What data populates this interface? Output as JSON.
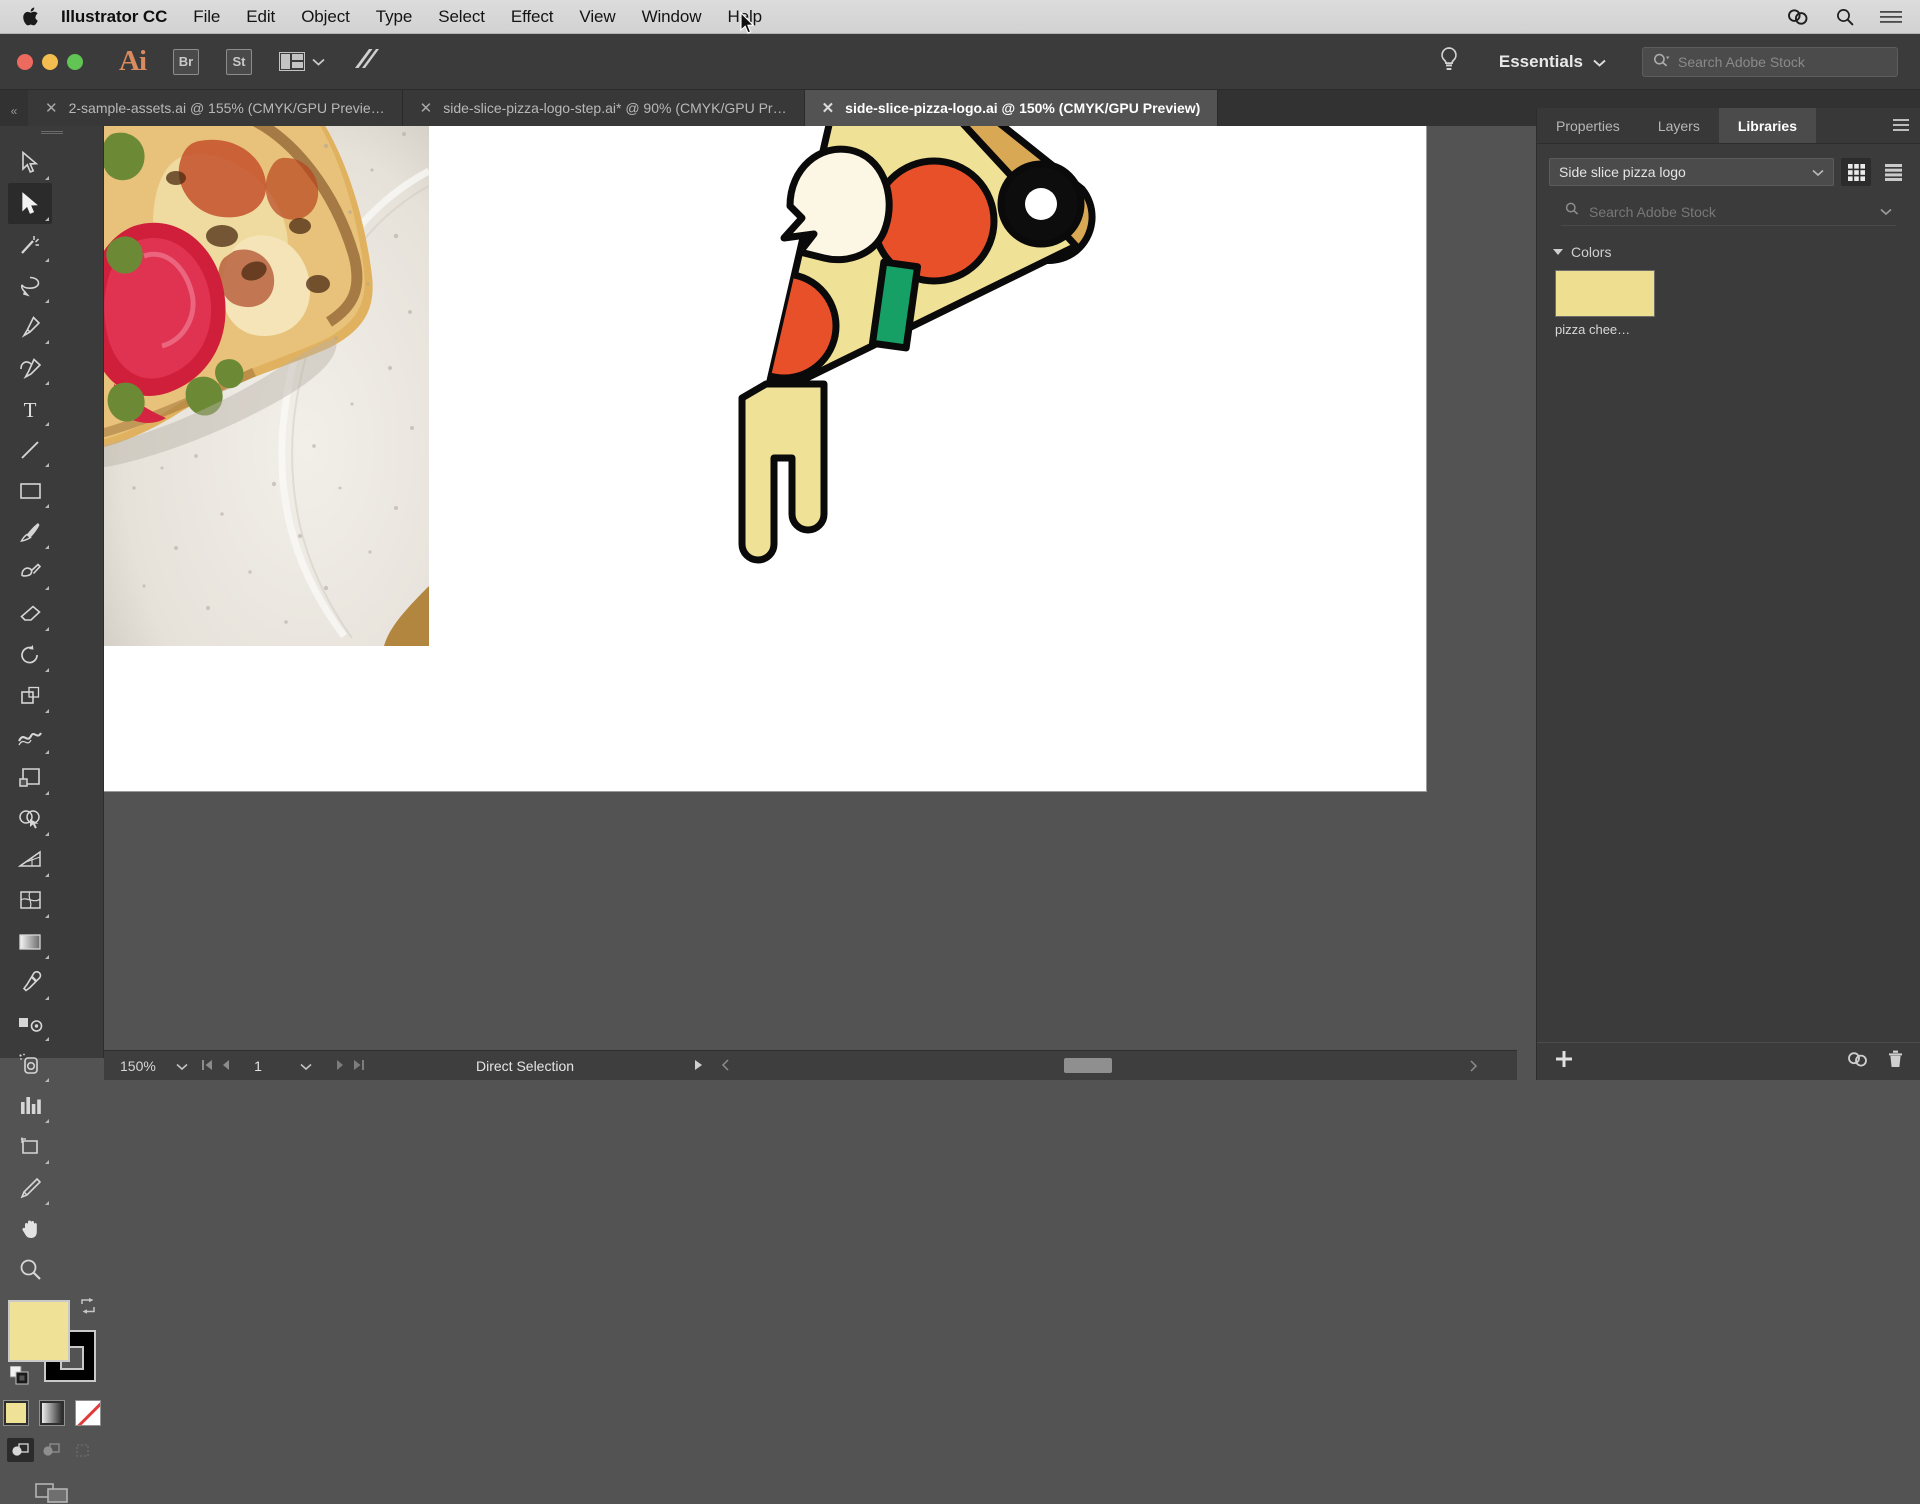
{
  "mac_menu": {
    "app_name": "Illustrator CC",
    "items": [
      "File",
      "Edit",
      "Object",
      "Type",
      "Select",
      "Effect",
      "View",
      "Window",
      "Help"
    ],
    "right_icons": [
      "creative-cloud-icon",
      "spotlight-search-icon",
      "control-center-icon"
    ]
  },
  "app_bar": {
    "logo": "Ai",
    "bridge_label": "Br",
    "stock_label": "St",
    "arrange_label": "arrange-documents-icon",
    "stylize_label": "stylize-icon",
    "bulb_label": "tips-icon",
    "workspace": "Essentials",
    "search_placeholder": "Search Adobe Stock"
  },
  "tabs": [
    {
      "title": "2-sample-assets.ai @ 155% (CMYK/GPU Previe…",
      "active": false
    },
    {
      "title": "side-slice-pizza-logo-step.ai* @ 90% (CMYK/GPU Pr…",
      "active": false
    },
    {
      "title": "side-slice-pizza-logo.ai @ 150% (CMYK/GPU Preview)",
      "active": true
    }
  ],
  "toolbar": {
    "tools": [
      "selection-tool",
      "direct-selection-tool",
      "magic-wand-tool",
      "lasso-tool",
      "pen-tool",
      "curvature-tool",
      "type-tool",
      "line-segment-tool",
      "rectangle-tool",
      "paintbrush-tool",
      "shaper-tool",
      "eraser-tool",
      "rotate-tool",
      "scale-tool",
      "width-tool",
      "free-transform-tool",
      "shape-builder-tool",
      "perspective-grid-tool",
      "mesh-tool",
      "gradient-tool",
      "eyedropper-tool",
      "blend-tool",
      "symbol-sprayer-tool",
      "column-graph-tool",
      "artboard-tool",
      "slice-tool",
      "hand-tool",
      "zoom-tool"
    ],
    "active_tool": "direct-selection-tool",
    "fill_color": "#efe196",
    "stroke_color": "#000000",
    "mini_swatches": [
      "color-swatch",
      "gradient-swatch",
      "none-swatch"
    ],
    "draw_modes": [
      "draw-normal",
      "draw-behind",
      "draw-inside"
    ],
    "screen_mode": "change-screen-mode"
  },
  "status_bar": {
    "zoom": "150%",
    "artboard_number": "1",
    "tool_indicator": "Direct Selection"
  },
  "right_panel": {
    "tabs": [
      {
        "label": "Properties",
        "active": false
      },
      {
        "label": "Layers",
        "active": false
      },
      {
        "label": "Libraries",
        "active": true
      }
    ],
    "library_name": "Side slice pizza logo",
    "view_modes": [
      "grid-view",
      "list-view"
    ],
    "active_view": "grid-view",
    "search_placeholder": "Search Adobe Stock",
    "sections": [
      {
        "title": "Colors",
        "expanded": true,
        "swatches": [
          {
            "label": "pizza chee…",
            "color": "#eede8f"
          }
        ]
      }
    ],
    "footer_icons": [
      "add-content-icon",
      "creative-cloud-sync-icon",
      "delete-icon"
    ]
  },
  "artwork": {
    "name": "side-slice-pizza-logo",
    "colors": {
      "cheese": "#efe196",
      "crust": "#d9a855",
      "pepperoni": "#e8502a",
      "pepper": "#17a065",
      "olive": "#0d0d0d",
      "mushroom": "#fcf6e4",
      "outline": "#0a0a0a"
    }
  }
}
